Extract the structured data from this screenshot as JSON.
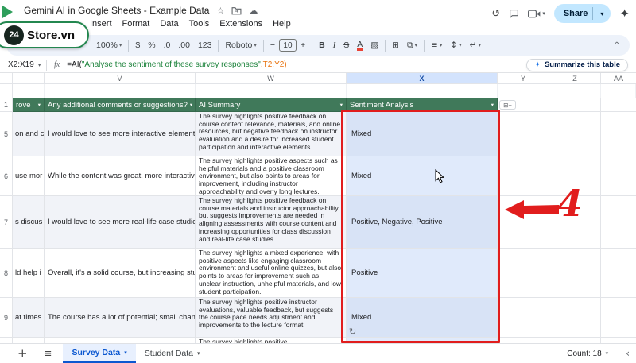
{
  "colors": {
    "table_header_green": "#40795a",
    "selection_blue": "#d3e3fd",
    "annotation_red": "#e11d1d",
    "share_button_bg": "#c2e7ff",
    "active_tab_blue": "#0b57d0"
  },
  "badge": {
    "number": "24",
    "name": "Store.vn"
  },
  "titlebar": {
    "title": "Gemini AI in Google Sheets - Example Data",
    "menus": [
      "Insert",
      "Format",
      "Data",
      "Tools",
      "Extensions",
      "Help"
    ],
    "share": "Share"
  },
  "toolbar": {
    "zoom": "100%",
    "currency": "$",
    "percent": "%",
    "decimal_decrease": ".0",
    "decimal_increase": ".00",
    "more_formats": "123",
    "font": "Roboto",
    "size_minus": "−",
    "font_size": "10",
    "size_plus": "+",
    "bold": "B",
    "italic": "I",
    "strikethrough": "S",
    "text_color": "A"
  },
  "formula_bar": {
    "name_box": "X2:X19",
    "fx": "fx",
    "formula_pre": "=AI(",
    "formula_string": "\"Analyse the sentiment of these survey responses\"",
    "formula_post": ",T2:Y2)",
    "summarize": "Summarize this table"
  },
  "grid": {
    "column_letters": [
      "V",
      "W",
      "X",
      "Y",
      "Z",
      "AA"
    ],
    "header": {
      "row_number": "1",
      "truncated": "rove",
      "comments": "Any additional comments or suggestions?",
      "summary": "AI Summary",
      "sentiment": "Sentiment Analysis",
      "add_column": "⊞+"
    },
    "rows": [
      {
        "number": "5",
        "truncated": "on and c",
        "comment": "I would love to see more interactive elements, like",
        "summary": "The survey highlights positive feedback on course content relevance, materials, and online resources, but negative feedback on instructor evaluation and a desire for increased student participation and interactive elements.",
        "sentiment": "Mixed"
      },
      {
        "number": "6",
        "truncated": "use mor",
        "comment": "While the content was great, more interactive lect",
        "summary": "The survey highlights positive aspects such as helpful materials and a positive classroom environment, but also points to areas for improvement, including instructor approachability and overly long lectures.",
        "sentiment": "Mixed"
      },
      {
        "number": "7",
        "truncated": "s discus",
        "comment": "I would love to see more real-life case studies inte",
        "summary": "The survey highlights positive feedback on course materials and instructor approachability, but suggests improvements are needed in aligning assessments with course content and increasing opportunities for class discussion and real-life case studies.",
        "sentiment": "Positive, Negative, Positive"
      },
      {
        "number": "8",
        "truncated": "ld help i",
        "comment": "Overall, it's a solid course, but increasing student p",
        "summary": "The survey highlights a mixed experience, with positive aspects like engaging classroom environment and useful online quizzes, but also points to areas for improvement such as unclear instruction, unhelpful materials, and low student participation.",
        "sentiment": "Positive"
      },
      {
        "number": "9",
        "truncated": "at times",
        "comment": "The course has a lot of potential; small changes to",
        "summary": "The survey highlights positive instructor evaluations, valuable feedback, but suggests the course pace needs adjustment and improvements to the lecture format.",
        "sentiment": "Mixed"
      }
    ],
    "partial_next_row": "The survey highlights positive"
  },
  "annotation": {
    "step": "4"
  },
  "footer": {
    "tab_survey": "Survey Data",
    "tab_student": "Student Data",
    "count": "Count: 18"
  },
  "icons": {
    "star": "☆",
    "cloud": "☁",
    "history": "↺",
    "sparkle": "✦",
    "dropdown": "▾",
    "collapse": "^",
    "plus": "+",
    "sheets_menu": "≡",
    "refresh": "↻",
    "back_chevron": "‹",
    "fill_color": "▨",
    "borders": "⊞",
    "merge": "⧉",
    "align": "≡",
    "vertical_align": "↕",
    "text_wrap": "↵"
  }
}
